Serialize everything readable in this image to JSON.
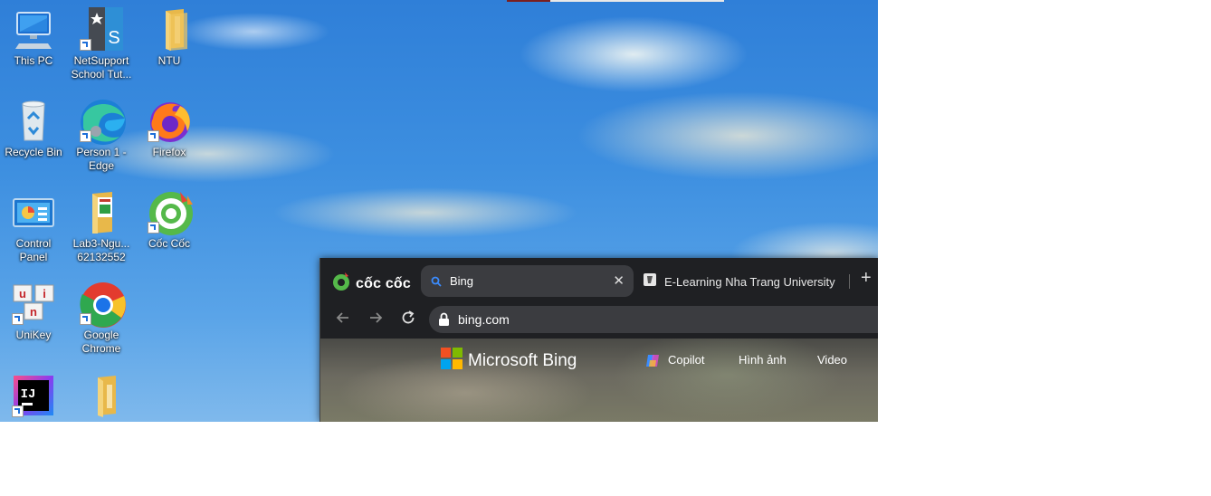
{
  "desktop": {
    "icons": [
      {
        "label": "This PC",
        "icon": "this-pc-icon"
      },
      {
        "label": "NetSupport School Tut...",
        "icon": "netsupport-icon"
      },
      {
        "label": "NTU",
        "icon": "folder-icon"
      },
      {
        "label": "Recycle Bin",
        "icon": "recycle-bin-icon"
      },
      {
        "label": "Person 1 - Edge",
        "icon": "edge-icon"
      },
      {
        "label": "Firefox",
        "icon": "firefox-icon"
      },
      {
        "label": "Control Panel",
        "icon": "control-panel-icon"
      },
      {
        "label": "Lab3-Ngu... 62132552",
        "icon": "document-folder-icon"
      },
      {
        "label": "Cốc Cốc",
        "icon": "coccoc-icon"
      },
      {
        "label": "UniKey",
        "icon": "unikey-icon"
      },
      {
        "label": "Google Chrome",
        "icon": "chrome-icon"
      },
      {
        "label": "",
        "icon": "intellij-icon"
      },
      {
        "label": "",
        "icon": "folder-icon"
      }
    ]
  },
  "browser": {
    "brand": "cốc cốc",
    "tabs": [
      {
        "title": "Bing",
        "active": true
      },
      {
        "title": "E-Learning Nha Trang University",
        "active": false
      }
    ],
    "new_tab": "+",
    "url": "bing.com",
    "page": {
      "logo_text": "Microsoft Bing",
      "nav": [
        "Copilot",
        "Hình ảnh",
        "Video"
      ]
    }
  },
  "colors": {
    "browser_bg": "#1f2023",
    "tab_active": "#3b3c40",
    "sky": "#3d8fe0"
  }
}
